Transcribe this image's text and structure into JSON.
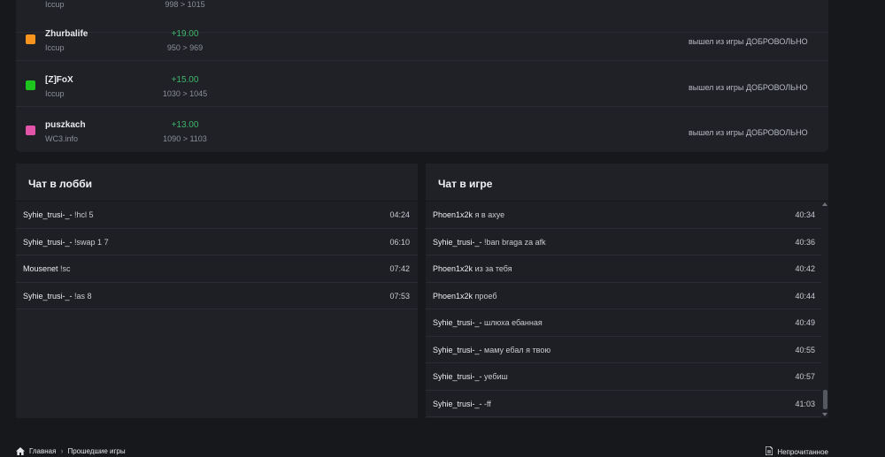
{
  "players": [
    {
      "name": "",
      "server": "Iccup",
      "delta": "",
      "range": "998 > 1015",
      "color": "#888888",
      "status": ""
    },
    {
      "name": "Zhurbalife",
      "server": "Iccup",
      "delta": "+19.00",
      "range": "950 > 969",
      "color": "#f7941d",
      "status": "вышел из игры ДОБРОВОЛЬНО"
    },
    {
      "name": "[Z]FoX",
      "server": "Iccup",
      "delta": "+15.00",
      "range": "1030 > 1045",
      "color": "#1dc41d",
      "status": "вышел из игры ДОБРОВОЛЬНО"
    },
    {
      "name": "puszkach",
      "server": "WC3.info",
      "delta": "+13.00",
      "range": "1090 > 1103",
      "color": "#e254a8",
      "status": "вышел из игры ДОБРОВОЛЬНО"
    }
  ],
  "lobby_chat": {
    "title": "Чат в лобби",
    "messages": [
      {
        "author": "Syhie_trusi-_-",
        "text": "!hcl 5",
        "time": "04:24"
      },
      {
        "author": "Syhie_trusi-_-",
        "text": "!swap 1 7",
        "time": "06:10"
      },
      {
        "author": "Mousenet",
        "text": "!sc",
        "time": "07:42"
      },
      {
        "author": "Syhie_trusi-_-",
        "text": "!as 8",
        "time": "07:53"
      }
    ]
  },
  "game_chat": {
    "title": "Чат в игре",
    "messages": [
      {
        "author": "Phoen1x2k",
        "text": "я в ахуе",
        "time": "40:34"
      },
      {
        "author": "Syhie_trusi-_-",
        "text": "!ban braga za afk",
        "time": "40:36"
      },
      {
        "author": "Phoen1x2k",
        "text": "из за тебя",
        "time": "40:42"
      },
      {
        "author": "Phoen1x2k",
        "text": "проеб",
        "time": "40:44"
      },
      {
        "author": "Syhie_trusi-_-",
        "text": "шлюха ебанная",
        "time": "40:49"
      },
      {
        "author": "Syhie_trusi-_-",
        "text": "маму ебал я твою",
        "time": "40:55"
      },
      {
        "author": "Syhie_trusi-_-",
        "text": "уебиш",
        "time": "40:57"
      },
      {
        "author": "Syhie_trusi-_-",
        "text": "-ff",
        "time": "41:03"
      }
    ]
  },
  "breadcrumb": {
    "home_icon": "home-icon",
    "items": [
      "Главная",
      "Прошедшие игры"
    ]
  },
  "unread": {
    "icon": "document-icon",
    "label": "Непрочитанное"
  },
  "colors": {
    "background": "#17181c",
    "panel": "#1f2127",
    "positive": "#3fb66b"
  }
}
